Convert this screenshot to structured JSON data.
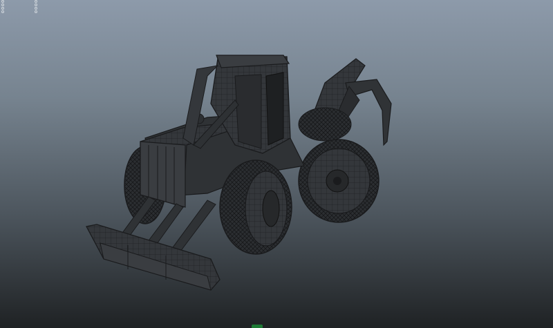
{
  "viewport": {
    "background_top": "#8d9aaa",
    "background_bottom": "#1f2224",
    "mesh_fill": "#2e3134",
    "mesh_line": "#1a1b1d",
    "highlight_line": "#5a6066"
  },
  "hud_indicator_count": 8,
  "model": {
    "subject": "skidder-wireframe-model",
    "display_mode": "wireframe-on-shaded"
  },
  "origin_marker_color": "#1e7a35"
}
